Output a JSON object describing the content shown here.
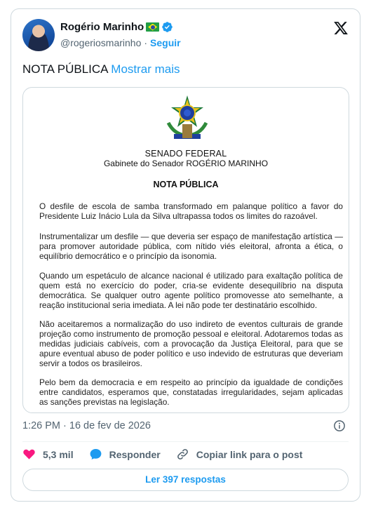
{
  "author": {
    "name": "Rogério Marinho",
    "handle": "@rogeriosmarinho",
    "separator": "·",
    "follow_label": "Seguir"
  },
  "tweet": {
    "text": "NOTA PÚBLICA",
    "show_more_label": "Mostrar mais"
  },
  "document": {
    "org_title": "SENADO FEDERAL",
    "office": "Gabinete do Senador ROGÉRIO MARINHO",
    "heading": "NOTA PÚBLICA",
    "paragraphs": [
      "O desfile de escola de samba transformado em palanque político a favor do Presidente Luiz Inácio Lula da Silva ultrapassa todos os limites do razoável.",
      "Instrumentalizar um desfile — que deveria ser espaço de manifestação artística — para promover autoridade pública, com nítido viés eleitoral, afronta a ética, o equilíbrio democrático e o princípio da isonomia.",
      "Quando um espetáculo de alcance nacional é utilizado para exaltação política de quem está no exercício do poder, cria-se evidente desequilíbrio na disputa democrática. Se qualquer outro agente político promovesse ato semelhante, a reação institucional seria imediata. A lei não pode ter destinatário escolhido.",
      "Não aceitaremos a normalização do uso indireto de eventos culturais de grande projeção como instrumento de promoção pessoal e eleitoral. Adotaremos todas as medidas judiciais cabíveis, com a provocação da Justiça Eleitoral, para que se apure eventual abuso de poder político e uso indevido de estruturas que deveriam servir a todos os brasileiros.",
      "Pelo bem da democracia e em respeito ao princípio da igualdade de condições entre candidatos, esperamos que, constatadas irregularidades, sejam aplicadas as sanções previstas na legislação."
    ]
  },
  "meta": {
    "timestamp": "1:26 PM · 16 de fev de 2026"
  },
  "actions": {
    "likes": "5,3 mil",
    "reply_label": "Responder",
    "copy_link_label": "Copiar link para o post"
  },
  "replies_button": "Ler 397 respostas",
  "colors": {
    "accent": "#1d9bf0",
    "like": "#f91880",
    "secondary_text": "#536471",
    "border": "#cfd9de"
  },
  "icons": [
    "flag-brazil-icon",
    "verified-badge-icon",
    "x-logo-icon",
    "coat-of-arms-icon",
    "info-icon",
    "heart-icon",
    "reply-bubble-icon",
    "link-icon"
  ]
}
